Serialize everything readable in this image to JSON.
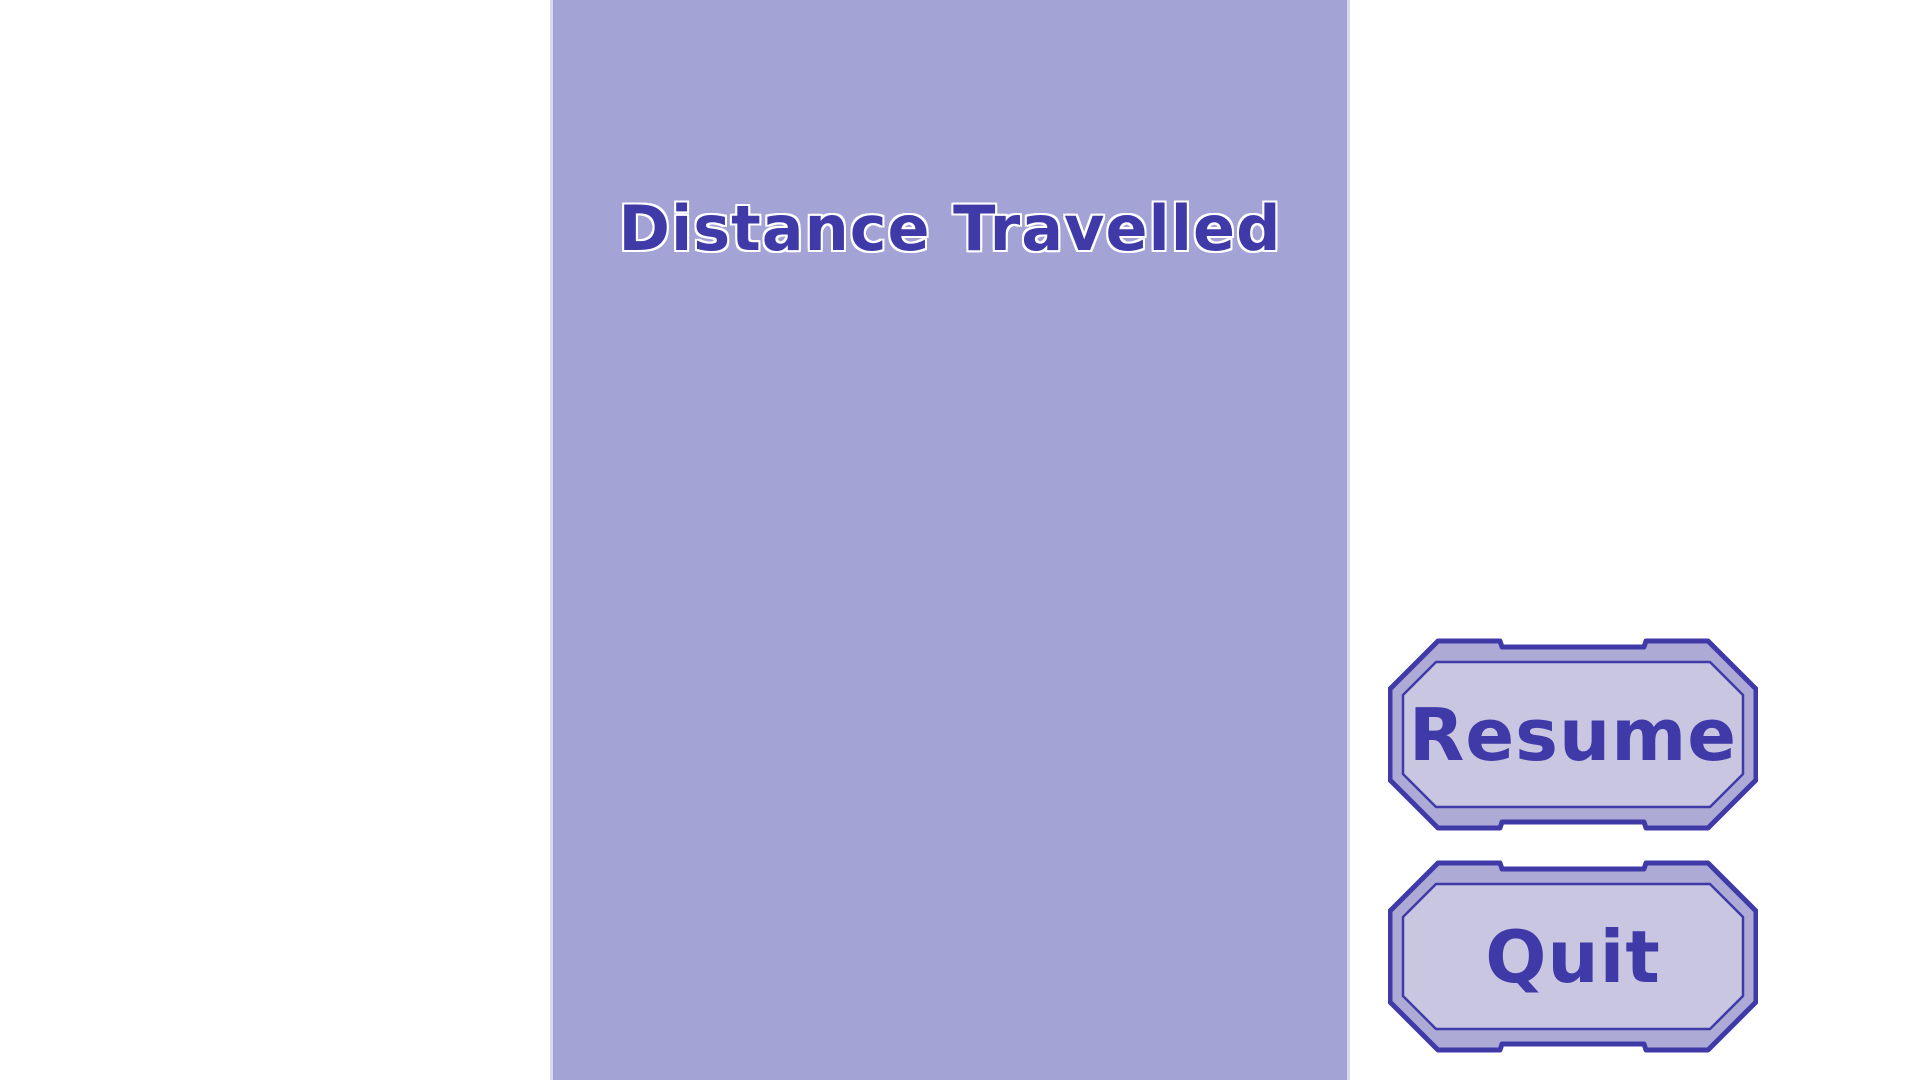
{
  "pause_menu": {
    "title": "Distance Travelled",
    "resume_label": "Resume",
    "quit_label": "Quit"
  },
  "colors": {
    "panel": "#a4a3d5",
    "accent": "#3f3aa8",
    "button_fill": "#c8c6e0",
    "button_rim": "#aeaad6"
  }
}
